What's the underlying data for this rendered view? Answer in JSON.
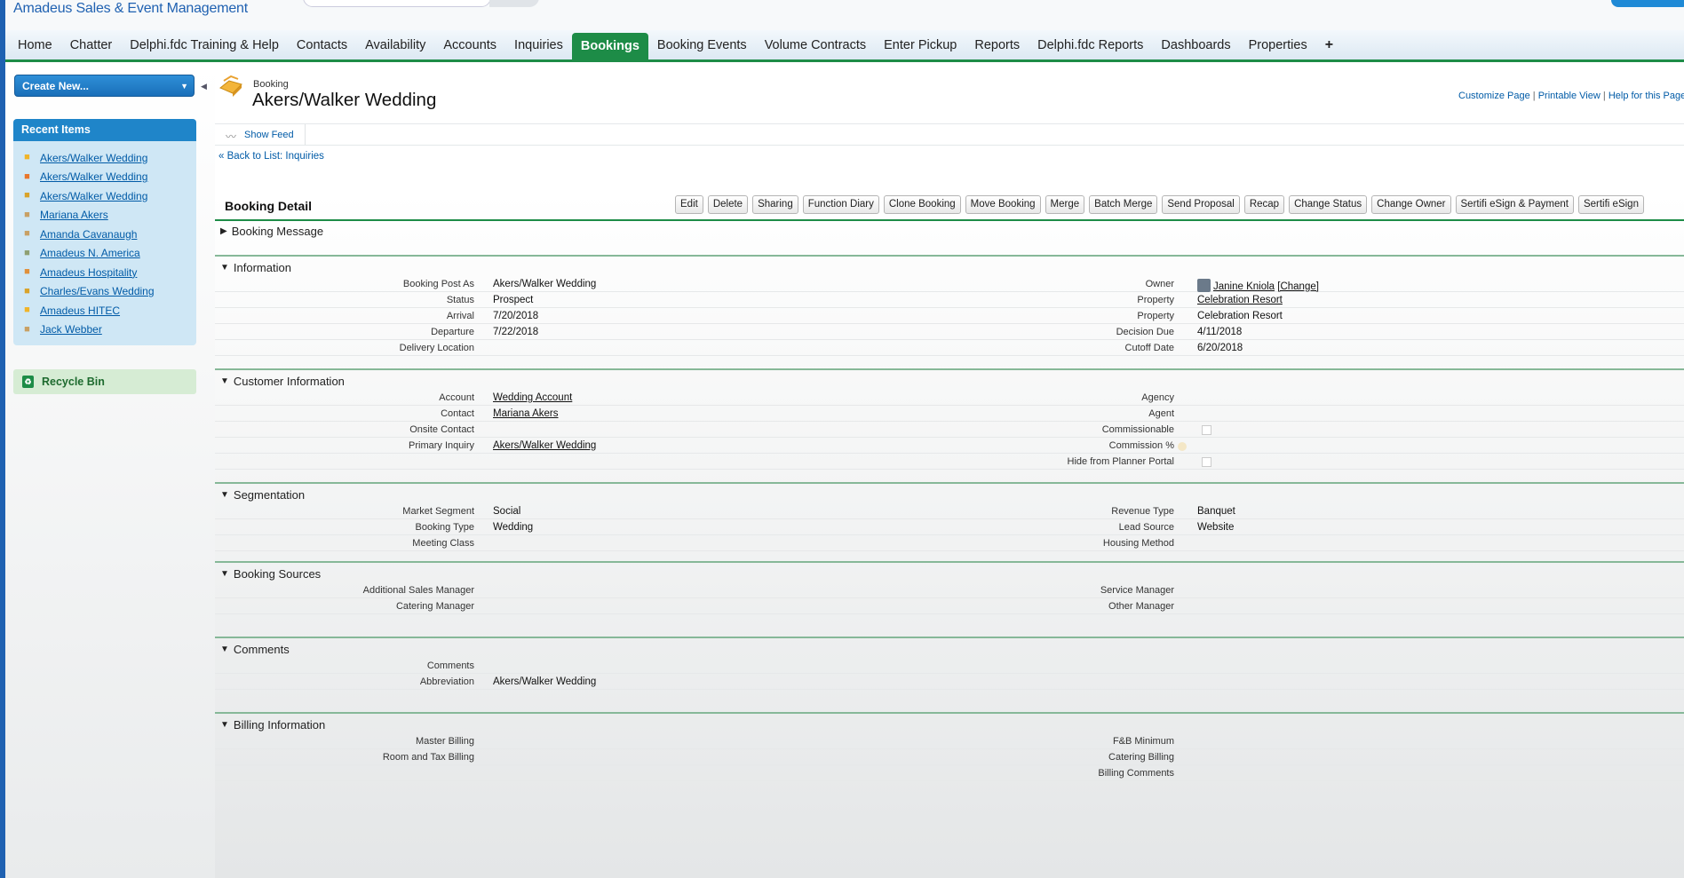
{
  "brand": {
    "name": "Amadeus Sales & Event Management"
  },
  "tabs": [
    "Home",
    "Chatter",
    "Delphi.fdc Training & Help",
    "Contacts",
    "Availability",
    "Accounts",
    "Inquiries",
    "Bookings",
    "Booking Events",
    "Volume Contracts",
    "Enter Pickup",
    "Reports",
    "Delphi.fdc Reports",
    "Dashboards",
    "Properties"
  ],
  "tabs_plus": "+",
  "sidebar": {
    "create_new": "Create New...",
    "recent_header": "Recent Items",
    "recent_items": [
      {
        "label": "Akers/Walker Wedding",
        "icon": "booking-icon",
        "color": "#f0b429"
      },
      {
        "label": "Akers/Walker Wedding",
        "icon": "event-icon",
        "color": "#e8762b"
      },
      {
        "label": "Akers/Walker Wedding",
        "icon": "inquiry-icon",
        "color": "#d9a32a"
      },
      {
        "label": "Mariana Akers",
        "icon": "contact-icon",
        "color": "#c8a064"
      },
      {
        "label": "Amanda Cavanaugh",
        "icon": "contact-icon",
        "color": "#c8a064"
      },
      {
        "label": "Amadeus N. America",
        "icon": "account-icon",
        "color": "#8fa072"
      },
      {
        "label": "Amadeus Hospitality",
        "icon": "account-icon",
        "color": "#e0903a"
      },
      {
        "label": "Charles/Evans Wedding",
        "icon": "inquiry-icon",
        "color": "#d9a32a"
      },
      {
        "label": "Amadeus HITEC",
        "icon": "booking-icon",
        "color": "#f0b429"
      },
      {
        "label": "Jack Webber",
        "icon": "contact-icon",
        "color": "#c8a064"
      }
    ],
    "recycle_bin": "Recycle Bin"
  },
  "page": {
    "type": "Booking",
    "title": "Akers/Walker Wedding",
    "links": [
      "Customize Page",
      "Printable View",
      "Help for this Page"
    ],
    "show_feed": "Show Feed",
    "back_link": "« Back to List: Inquiries"
  },
  "detail": {
    "title": "Booking Detail",
    "buttons": [
      "Edit",
      "Delete",
      "Sharing",
      "Function Diary",
      "Clone Booking",
      "Move Booking",
      "Merge",
      "Batch Merge",
      "Send Proposal",
      "Recap",
      "Change Status",
      "Change Owner",
      "Sertifi eSign & Payment",
      "Sertifi eSign"
    ]
  },
  "sections": {
    "booking_message": "Booking Message",
    "information": {
      "title": "Information",
      "rows": [
        {
          "l1": "Booking Post As",
          "v1": "Akers/Walker Wedding",
          "l2": "Owner",
          "v2": "Janine Kniola",
          "v2_extra": "[Change]"
        },
        {
          "l1": "Status",
          "v1": "Prospect",
          "l2": "Property",
          "v2": "Celebration Resort"
        },
        {
          "l1": "Arrival",
          "v1": "7/20/2018",
          "l2": "Property",
          "v2": "Celebration Resort"
        },
        {
          "l1": "Departure",
          "v1": "7/22/2018",
          "l2": "Decision Due",
          "v2": "4/11/2018"
        },
        {
          "l1": "Delivery Location",
          "v1": "",
          "l2": "Cutoff Date",
          "v2": "6/20/2018"
        }
      ]
    },
    "customer": {
      "title": "Customer Information",
      "rows": [
        {
          "l1": "Account",
          "v1": "Wedding Account",
          "l2": "Agency",
          "v2": ""
        },
        {
          "l1": "Contact",
          "v1": "Mariana Akers",
          "l2": "Agent",
          "v2": ""
        },
        {
          "l1": "Onsite Contact",
          "v1": "",
          "l2": "Commissionable",
          "v2": ""
        },
        {
          "l1": "Primary Inquiry",
          "v1": "Akers/Walker Wedding",
          "l2": "Commission %",
          "v2": ""
        },
        {
          "l1": "",
          "v1": "",
          "l2": "Hide from Planner Portal",
          "v2": ""
        }
      ]
    },
    "segmentation": {
      "title": "Segmentation",
      "rows": [
        {
          "l1": "Market Segment",
          "v1": "Social",
          "l2": "Revenue Type",
          "v2": "Banquet"
        },
        {
          "l1": "Booking Type",
          "v1": "Wedding",
          "l2": "Lead Source",
          "v2": "Website"
        },
        {
          "l1": "Meeting Class",
          "v1": "",
          "l2": "Housing Method",
          "v2": ""
        }
      ]
    },
    "sources": {
      "title": "Booking Sources",
      "rows": [
        {
          "l1": "Additional Sales Manager",
          "v1": "",
          "l2": "Service Manager",
          "v2": ""
        },
        {
          "l1": "Catering Manager",
          "v1": "",
          "l2": "Other Manager",
          "v2": ""
        }
      ]
    },
    "comments": {
      "title": "Comments",
      "rows": [
        {
          "l1": "Comments",
          "v1": "",
          "l2": "",
          "v2": ""
        },
        {
          "l1": "Abbreviation",
          "v1": "Akers/Walker Wedding",
          "l2": "",
          "v2": ""
        }
      ]
    },
    "billing": {
      "title": "Billing Information",
      "rows": [
        {
          "l1": "Master Billing",
          "v1": "",
          "l2": "F&B Minimum",
          "v2": ""
        },
        {
          "l1": "Room and Tax Billing",
          "v1": "",
          "l2": "Catering Billing",
          "v2": ""
        },
        {
          "l1": "",
          "v1": "",
          "l2": "Billing Comments",
          "v2": ""
        }
      ]
    }
  },
  "colors": {
    "brand_blue": "#1f61b1",
    "accent_green": "#1d8c47",
    "link_blue": "#015ba7"
  }
}
